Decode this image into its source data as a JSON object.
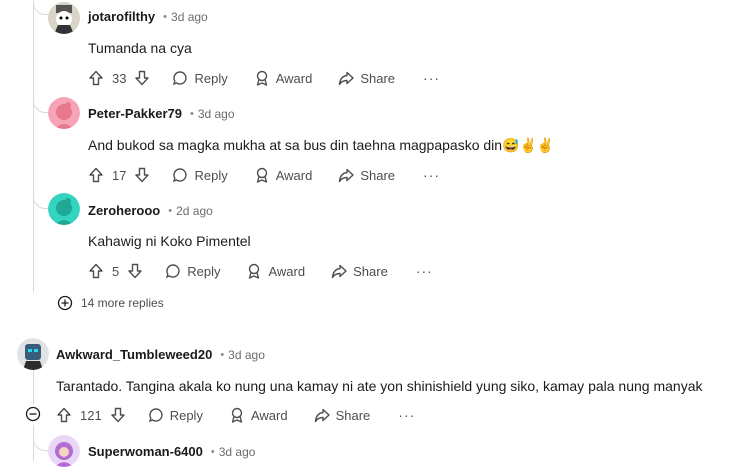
{
  "comments": [
    {
      "username": "jotarofilthy",
      "age": "3d ago",
      "text": "Tumanda na cya",
      "votes": "33",
      "reply": "Reply",
      "award": "Award",
      "share": "Share",
      "more": "···"
    },
    {
      "username": "Peter-Pakker79",
      "age": "3d ago",
      "text": "And bukod sa magka mukha at sa bus din taehna magpapasko din",
      "emoji": "😅✌✌",
      "votes": "17",
      "reply": "Reply",
      "award": "Award",
      "share": "Share",
      "more": "···"
    },
    {
      "username": "Zeroherooo",
      "age": "2d ago",
      "text": "Kahawig ni Koko Pimentel",
      "votes": "5",
      "reply": "Reply",
      "award": "Award",
      "share": "Share",
      "more": "···"
    },
    {
      "username": "Awkward_Tumbleweed20",
      "age": "3d ago",
      "text": "Tarantado. Tangina akala ko nung una kamay ni ate yon shinishield yung siko, kamay pala nung manyak",
      "votes": "121",
      "reply": "Reply",
      "award": "Award",
      "share": "Share",
      "more": "···"
    },
    {
      "username": "Superwoman-6400",
      "age": "3d ago"
    }
  ],
  "more_replies": "14 more replies",
  "separator": "•",
  "colors": {
    "peter_avatar": "#f8a4b8",
    "zero_avatar": "#33d4c0",
    "awkward_avatar": "#3a5d7a",
    "super_avatar": "#b36bd6"
  }
}
